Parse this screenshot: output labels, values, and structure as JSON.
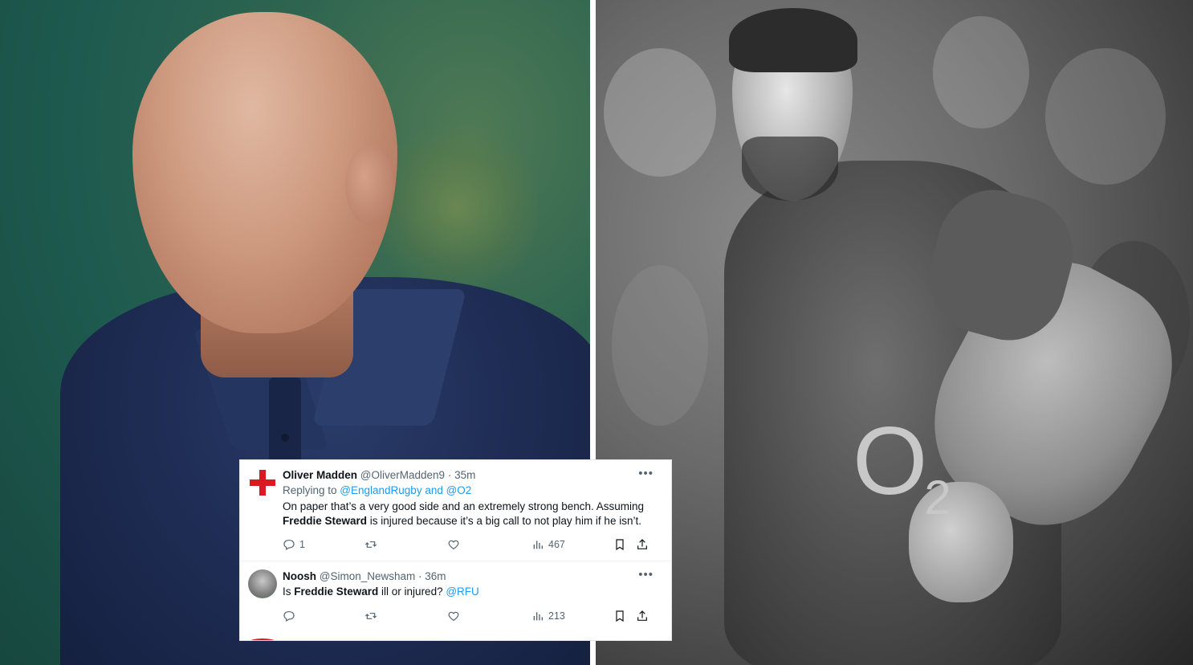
{
  "photos": {
    "left_icon": "person-photo",
    "right_icon": "rugby-player-photo",
    "shirt_sponsor": "O",
    "shirt_sponsor_sub": "2"
  },
  "tweets": [
    {
      "avatar_icon": "england-flag-icon",
      "name": "Oliver Madden",
      "handle": "@OliverMadden9",
      "separator": " · ",
      "time": "35m",
      "reply_prefix": "Replying to ",
      "reply_to": "@EnglandRugby and @O2",
      "text_line1": "On paper that’s a very good side and an extremely strong bench. Assuming",
      "text_bold": "Freddie Steward",
      "text_line2_rest": " is injured because it’s a big call to not play him if he isn’t.",
      "replies": "1",
      "retweets": "",
      "likes": "",
      "views": "467"
    },
    {
      "avatar_icon": "user-avatar-icon",
      "name": "Noosh",
      "handle": "@Simon_Newsham",
      "separator": " · ",
      "time": "36m",
      "text_prefix": "Is ",
      "text_bold": "Freddie Steward",
      "text_mid": " ill or injured? ",
      "text_link": "@RFU",
      "replies": "",
      "retweets": "",
      "likes": "",
      "views": "213"
    }
  ],
  "colors": {
    "link": "#1d9bf0",
    "muted": "#536471",
    "text": "#0f1419",
    "flag_red": "#d91a21"
  }
}
